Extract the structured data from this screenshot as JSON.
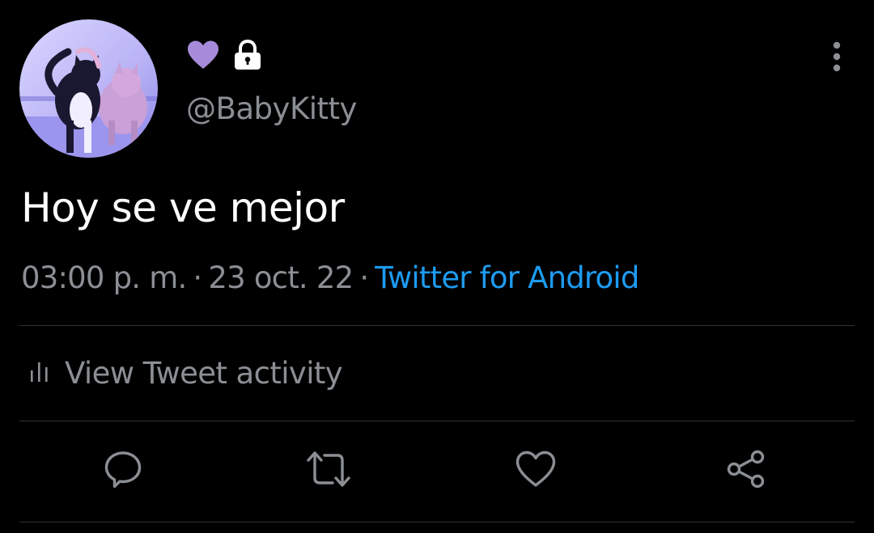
{
  "user": {
    "handle": "@BabyKitty",
    "display_name_icons": [
      "heart-icon",
      "lock-icon"
    ],
    "heart_color": "#a78bdb",
    "lock_color": "#ffffff"
  },
  "tweet": {
    "text": "Hoy se ve mejor",
    "time": "03:00 p. m.",
    "separator": "·",
    "date": "23 oct. 22",
    "source": "Twitter for Android"
  },
  "activity": {
    "label": "View Tweet activity",
    "icon": "bar-chart-icon"
  },
  "actions": {
    "icons": [
      "reply-icon",
      "retweet-icon",
      "like-icon",
      "share-icon"
    ]
  },
  "colors": {
    "background": "#000000",
    "text_primary": "#ffffff",
    "text_secondary": "#8b8f94",
    "link": "#1d9bf0",
    "divider": "#2f3336"
  }
}
